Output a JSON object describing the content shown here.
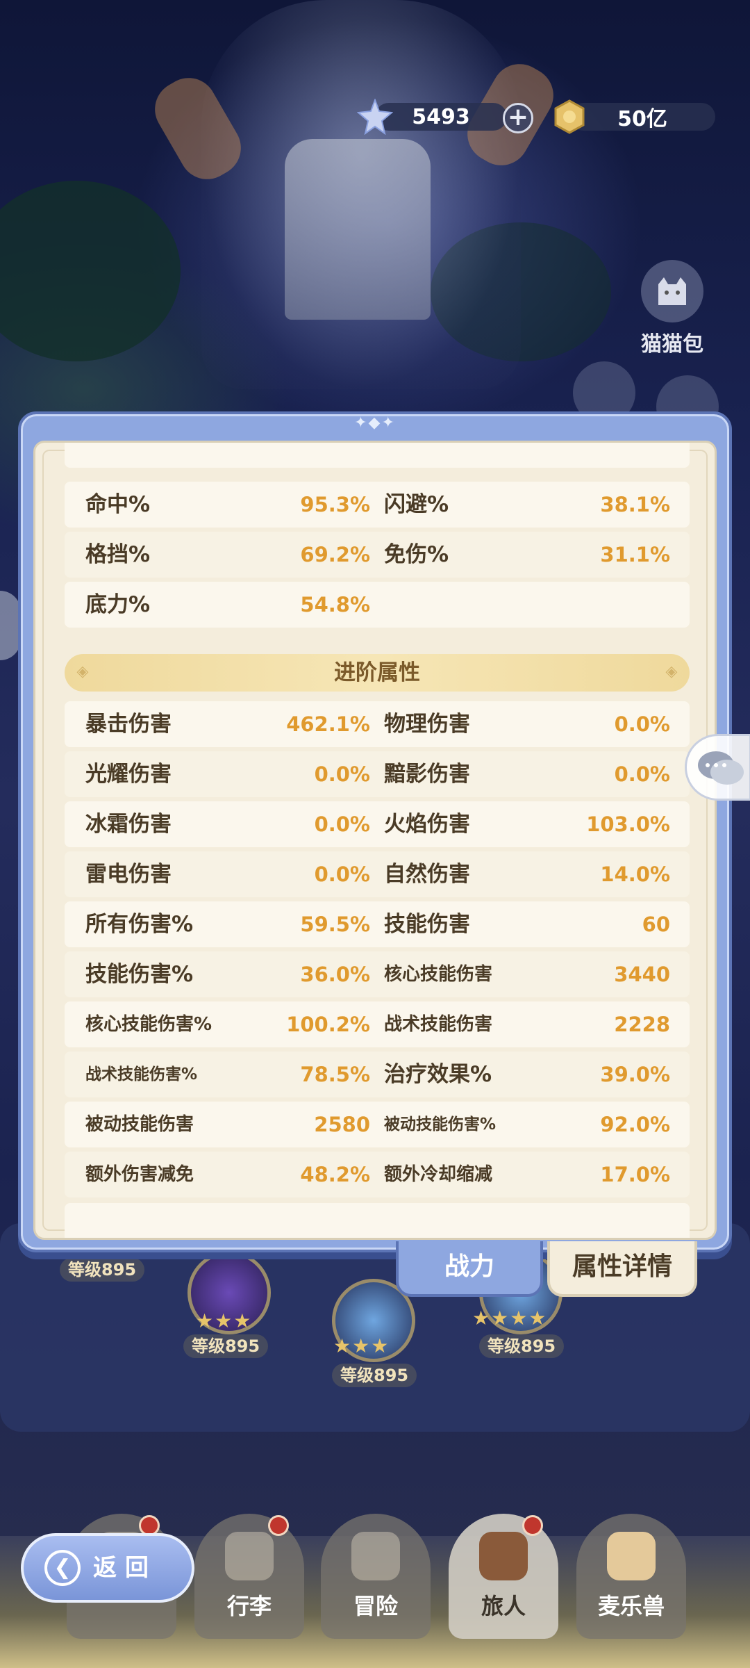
{
  "currency": {
    "gems": "5493",
    "gold": "50亿",
    "plus_label": "+"
  },
  "side": {
    "cat_bag_label": "猫猫包"
  },
  "stats": {
    "partial_row": {
      "label1": "",
      "value1": "",
      "label2": "",
      "value2": ""
    },
    "basic_rows": [
      {
        "label1": "命中%",
        "value1": "95.3%",
        "label2": "闪避%",
        "value2": "38.1%"
      },
      {
        "label1": "格挡%",
        "value1": "69.2%",
        "label2": "免伤%",
        "value2": "31.1%"
      },
      {
        "label1": "底力%",
        "value1": "54.8%",
        "label2": "",
        "value2": ""
      }
    ],
    "advanced_title": "进阶属性",
    "advanced_rows": [
      {
        "label1": "暴击伤害",
        "value1": "462.1%",
        "label2": "物理伤害",
        "value2": "0.0%"
      },
      {
        "label1": "光耀伤害",
        "value1": "0.0%",
        "label2": "黯影伤害",
        "value2": "0.0%"
      },
      {
        "label1": "冰霜伤害",
        "value1": "0.0%",
        "label2": "火焰伤害",
        "value2": "103.0%"
      },
      {
        "label1": "雷电伤害",
        "value1": "0.0%",
        "label2": "自然伤害",
        "value2": "14.0%"
      },
      {
        "label1": "所有伤害%",
        "value1": "59.5%",
        "label2": "技能伤害",
        "value2": "60"
      },
      {
        "label1": "技能伤害%",
        "value1": "36.0%",
        "label2": "核心技能伤害",
        "value2": "3440"
      },
      {
        "label1": "核心技能伤害%",
        "value1": "100.2%",
        "label2": "战术技能伤害",
        "value2": "2228"
      },
      {
        "label1": "战术技能伤害%",
        "value1": "78.5%",
        "label2": "治疗效果%",
        "value2": "39.0%"
      },
      {
        "label1": "被动技能伤害",
        "value1": "2580",
        "label2": "被动技能伤害%",
        "value2": "92.0%"
      },
      {
        "label1": "额外伤害减免",
        "value1": "48.2%",
        "label2": "额外冷却缩减",
        "value2": "17.0%"
      }
    ]
  },
  "tabs": {
    "power": "战力",
    "detail": "属性详情"
  },
  "levels": {
    "left": "等级895",
    "mid1": "等级895",
    "mid2": "等级895",
    "right": "等级895"
  },
  "nav": {
    "back": "返回",
    "luggage": "行李",
    "adventure": "冒险",
    "traveler": "旅人",
    "pet": "麦乐兽"
  },
  "colors": {
    "value_accent": "#e09a2e",
    "label_text": "#4a3b26",
    "panel_frame": "#8ea7e0",
    "panel_paper": "#f4eddc"
  }
}
